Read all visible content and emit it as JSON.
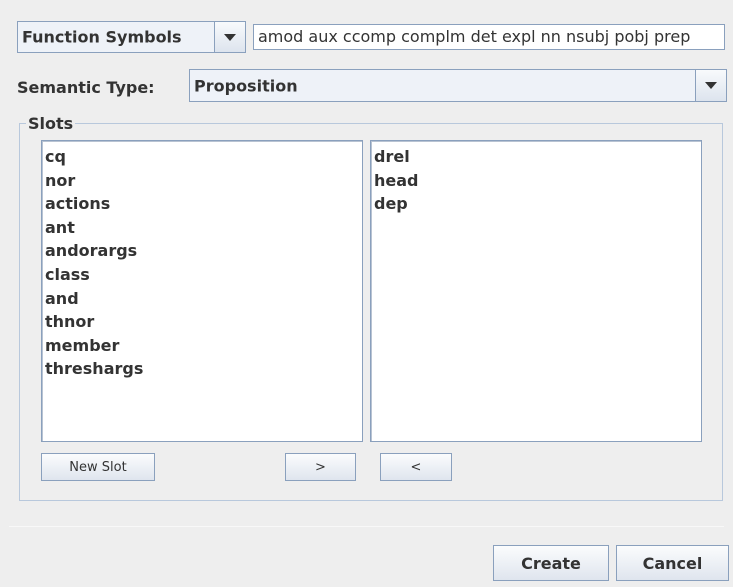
{
  "function_symbols": {
    "combo_label": "Function Symbols",
    "text_value": "amod aux ccomp complm det expl nn nsubj pobj prep"
  },
  "semantic_type": {
    "label": "Semantic Type:",
    "value": "Proposition"
  },
  "slots": {
    "title": "Slots",
    "left_list": [
      "cq",
      "nor",
      "actions",
      "ant",
      "andorargs",
      "class",
      "and",
      "thnor",
      "member",
      "threshargs"
    ],
    "right_list": [
      "drel",
      "head",
      "dep"
    ],
    "new_slot_label": "New Slot",
    "move_right_label": ">",
    "move_left_label": "<"
  },
  "footer": {
    "create_label": "Create",
    "cancel_label": "Cancel"
  },
  "colors": {
    "background": "#eeeeee",
    "border": "#8aa0bd",
    "combo_bg": "#eef2f8"
  }
}
